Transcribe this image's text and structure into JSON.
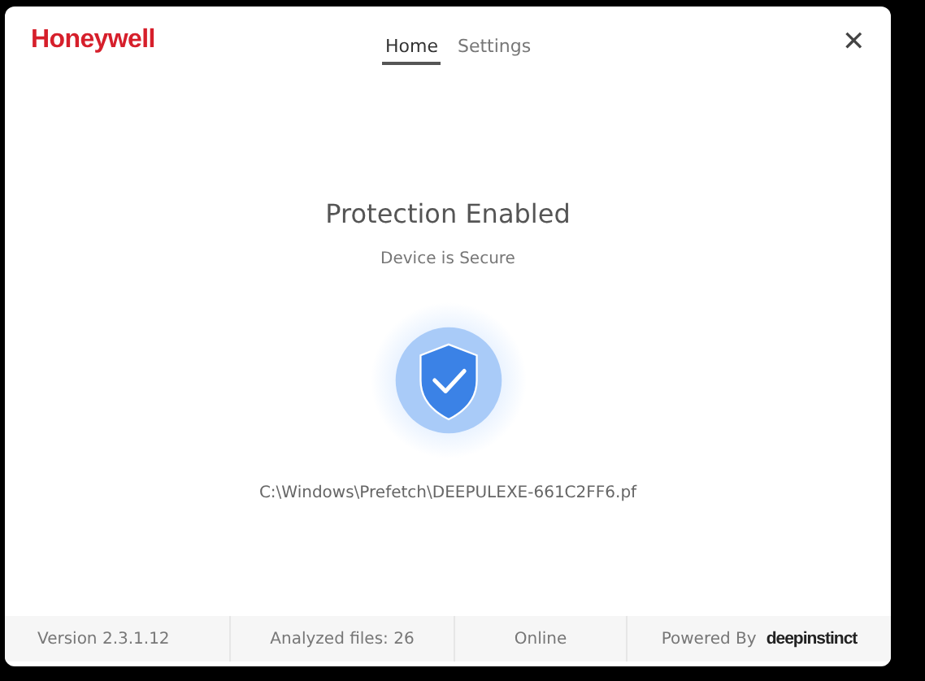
{
  "window": {
    "logo": "Honeywell",
    "close_label": "✕"
  },
  "tabs": [
    {
      "label": "Home",
      "selected": true
    },
    {
      "label": "Settings",
      "selected": false
    }
  ],
  "status": {
    "title": "Protection Enabled",
    "subtitle": "Device is Secure",
    "secure": true,
    "current_file": "C:\\Windows\\Prefetch\\DEEPULEXE-661C2FF6.pf"
  },
  "status_bar": {
    "version": "Version 2.3.1.12",
    "analyzed": "Analyzed files: 26",
    "connection": "Online",
    "powered_by": "Powered By",
    "vendor_logo": "deepinstinct"
  }
}
